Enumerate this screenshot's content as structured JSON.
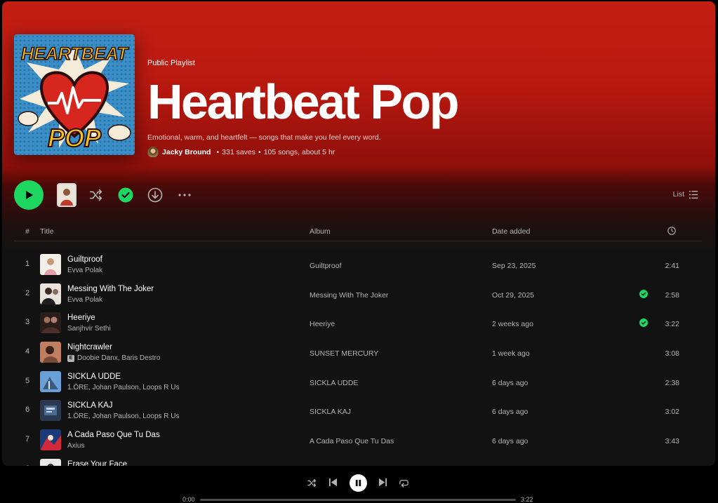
{
  "playlist": {
    "type": "Public Playlist",
    "title": "Heartbeat Pop",
    "description": "Emotional, warm, and heartfelt — songs that make you feel every word.",
    "owner": "Jacky Bround",
    "saves": "331 saves",
    "stats": "105 songs, about 5 hr",
    "cover": {
      "line1": "HEARTBEAT",
      "line2": "POP"
    }
  },
  "actions": {
    "view_label": "List",
    "more": "•••"
  },
  "table": {
    "columns": {
      "num": "#",
      "title": "Title",
      "album": "Album",
      "date": "Date added"
    },
    "rows": [
      {
        "num": "1",
        "title": "Guiltproof",
        "artist": "Evva Polak",
        "explicit": false,
        "album": "Guiltproof",
        "date": "Sep 23, 2025",
        "saved": false,
        "duration": "2:41"
      },
      {
        "num": "2",
        "title": "Messing With The Joker",
        "artist": "Evva Polak",
        "explicit": false,
        "album": "Messing With The Joker",
        "date": "Oct 29, 2025",
        "saved": true,
        "duration": "2:58"
      },
      {
        "num": "3",
        "title": "Heeriye",
        "artist": "Sanjhvir Sethi",
        "explicit": false,
        "album": "Heeriye",
        "date": "2 weeks ago",
        "saved": true,
        "duration": "3:22"
      },
      {
        "num": "4",
        "title": "Nightcrawler",
        "artist": "Doobie Danx, Baris Destro",
        "explicit": true,
        "album": "SUNSET MERCURY",
        "date": "1 week ago",
        "saved": false,
        "duration": "3:08"
      },
      {
        "num": "5",
        "title": "SICKLA UDDE",
        "artist": "1.ÖRE, Johan Paulson, Loops R Us",
        "explicit": false,
        "album": "SICKLA UDDE",
        "date": "6 days ago",
        "saved": false,
        "duration": "2:38"
      },
      {
        "num": "6",
        "title": "SICKLA KAJ",
        "artist": "1.ÖRE, Johan Paulson, Loops R Us",
        "explicit": false,
        "album": "SICKLA KAJ",
        "date": "6 days ago",
        "saved": false,
        "duration": "3:02"
      },
      {
        "num": "7",
        "title": "A Cada Paso Que Tu Das",
        "artist": "Axius",
        "explicit": false,
        "album": "A Cada Paso Que Tu Das",
        "date": "6 days ago",
        "saved": false,
        "duration": "3:43"
      },
      {
        "num": "8",
        "title": "Erase Your Face",
        "artist": "",
        "explicit": false,
        "album": "",
        "date": "",
        "saved": false,
        "duration": ""
      }
    ]
  },
  "player": {
    "elapsed": "0:00",
    "total": "3:22",
    "progress": 0
  },
  "colors": {
    "accent": "#1ed760",
    "header": "#c41e14"
  },
  "icons": {
    "play": "play-icon",
    "shuffle": "shuffle-icon",
    "saved": "check-circle-icon",
    "download": "download-icon",
    "more": "more-icon",
    "list": "list-icon",
    "clock": "clock-icon",
    "prev": "skip-back-icon",
    "next": "skip-forward-icon",
    "pause": "pause-icon",
    "repeat": "repeat-icon"
  }
}
